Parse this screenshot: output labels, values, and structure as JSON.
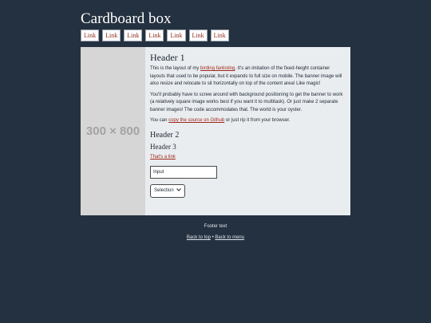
{
  "site": {
    "title": "Cardboard box"
  },
  "nav": {
    "items": [
      "Link",
      "Link",
      "Link",
      "Link",
      "Link",
      "Link",
      "Link"
    ]
  },
  "banner": {
    "text": "300 × 800"
  },
  "main": {
    "h1": "Header 1",
    "p1_before": "This is the layout of my ",
    "p1_link": "birding fanlisting",
    "p1_after": ". It's an imitation of the fixed-height container layouts that used to be popular, but it expands to full size on mobile. The banner image will also resize and relocate to sit horizontally on top of the content area! Like magic!",
    "p2": "You'll probably have to screw around with background positioning to get the banner to work (a relatively square image works best if you want it to multitask). Or just make 2 separate banner images! The code accommodates that. The world is your oyster.",
    "p3_before": "You can ",
    "p3_link": "copy the source on Github",
    "p3_after": " or just rip it from your browser.",
    "h2": "Header 2",
    "h3": "Header 3",
    "link": "That's a link",
    "input_value": "Input",
    "select_value": "Selection"
  },
  "footer": {
    "text": "Footer text",
    "back_to_top": "Back to top",
    "separator": "•",
    "back_to_menu": "Back to menu"
  }
}
